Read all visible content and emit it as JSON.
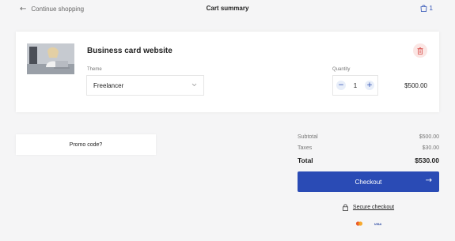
{
  "header": {
    "back_label": "Continue shopping",
    "title": "Cart summary",
    "cart_count": "1",
    "accent_color": "#2a4db3"
  },
  "item": {
    "name": "Business card website",
    "theme_label": "Theme",
    "theme_value": "Freelancer",
    "quantity_label": "Quantity",
    "quantity": "1",
    "decrement_symbol": "−",
    "increment_symbol": "+",
    "price": "$500.00"
  },
  "promo": {
    "label": "Promo code?"
  },
  "summary": {
    "subtotal_label": "Subtotal",
    "subtotal_value": "$500.00",
    "taxes_label": "Taxes",
    "taxes_value": "$30.00",
    "total_label": "Total",
    "total_value": "$530.00"
  },
  "checkout": {
    "label": "Checkout",
    "button_color": "#2a4bb5"
  },
  "secure": {
    "label": "Secure checkout"
  },
  "payment": {
    "visa_text": "VISA",
    "icons": [
      "mastercard-icon",
      "visa-icon"
    ]
  }
}
